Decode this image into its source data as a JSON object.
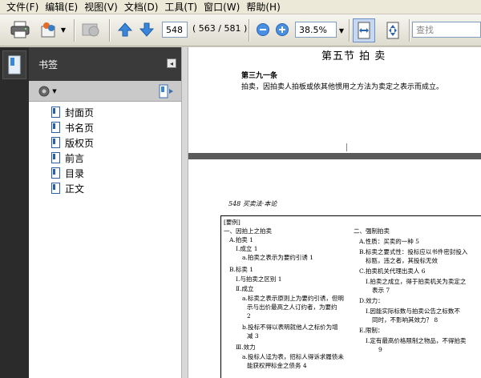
{
  "menu": [
    "文件(F)",
    "编辑(E)",
    "视图(V)",
    "文档(D)",
    "工具(T)",
    "窗口(W)",
    "帮助(H)"
  ],
  "toolbar": {
    "page_number": "548",
    "page_count": "( 563 / 581 )",
    "zoom": "38.5%",
    "search_placeholder": "查找"
  },
  "bookmarks": {
    "title": "书签",
    "items": [
      "封面页",
      "书名页",
      "版权页",
      "前言",
      "目录",
      "正文"
    ]
  },
  "document": {
    "page1": {
      "section_title": "第五节 拍 卖",
      "article": "第三九一条",
      "body": "拍卖，因拍卖人拍板或依其他惯用之方法为卖定之表示而成立。"
    },
    "page2": {
      "running_header": "548 买卖法·本论",
      "left_col": [
        "[要例]",
        "一、因拍上之拍卖",
        "A.拍卖 1",
        "Ⅰ.成立 1",
        "a.拍卖之表示为要约引诱 1",
        "B.标卖 1",
        "Ⅰ.与拍卖之区别 1",
        "Ⅱ.成立",
        "a.标卖之表示原则上为要约引诱，但明",
        "示与出价最高之人订约者，为要约",
        "2",
        "b.投标不得以表明就他人之标价为增",
        "减 3",
        "Ⅲ.效力",
        "a.投标人迳为表，招标人得诉求履债未",
        "能获权押标金之债务 4"
      ],
      "right_col": [
        "二、强制拍卖",
        "A.性质：买卖的一种 5",
        "B.标卖之要式性：投标应以书件密封投入",
        "标匦，违之者，其投标无效",
        "C.拍卖机关代理出卖人 6",
        "Ⅰ.拍卖之成立，得于拍卖机关为卖定之",
        "表示 7",
        "D.效力：",
        "Ⅰ.因能实际标数与拍卖公告之标数不",
        "同时，不影响其效力？ 8",
        "E.限制：",
        "Ⅰ.定有最高价格限制之物品，不得拍卖",
        "9"
      ]
    }
  }
}
